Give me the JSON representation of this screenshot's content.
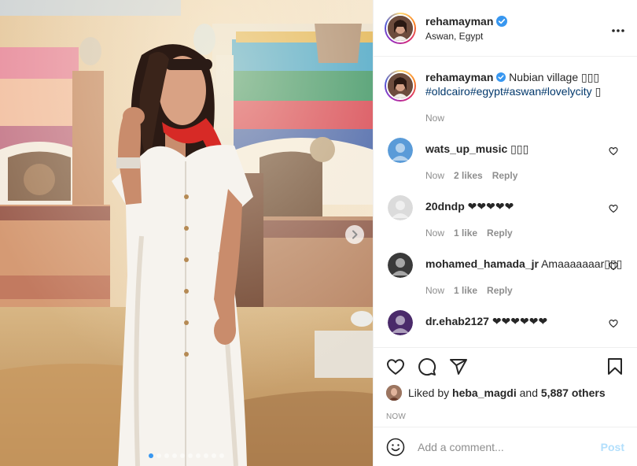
{
  "post": {
    "username": "rehamayman",
    "location": "Aswan, Egypt",
    "more_icon": "more-horizontal-icon"
  },
  "caption": {
    "username": "rehamayman",
    "text": "Nubian village ▯▯▯",
    "hashtags": "#oldcairo#egypt#aswan#lovelycity",
    "trailing": "▯",
    "time": "Now"
  },
  "comments": [
    {
      "username": "wats_up_music",
      "text": "▯▯▯",
      "time": "Now",
      "likes": "2 likes",
      "reply": "Reply",
      "avatar_color": "#5a9bd8"
    },
    {
      "username": "20dndp",
      "text": "❤❤❤❤❤",
      "time": "Now",
      "likes": "1 like",
      "reply": "Reply",
      "avatar_color": "#dbdbdb"
    },
    {
      "username": "mohamed_hamada_jr",
      "text": "Amaaaaaaar▯▯▯",
      "time": "Now",
      "likes": "1 like",
      "reply": "Reply",
      "avatar_color": "#3a3a3a"
    },
    {
      "username": "dr.ehab2127",
      "text": "❤❤❤❤❤❤",
      "time": "",
      "likes": "",
      "reply": "",
      "avatar_color": "#4a2a6a"
    }
  ],
  "likes": {
    "prefix": "Liked by",
    "user": "heba_magdi",
    "and": "and",
    "others": "5,887 others"
  },
  "timestamp": "NOW",
  "add_comment": {
    "placeholder": "Add a comment...",
    "post_label": "Post"
  },
  "carousel": {
    "total": 10,
    "active": 1
  },
  "colors": {
    "verified": "#3897f0",
    "link": "#00376b",
    "muted": "#8e8e8e",
    "post_disabled": "#b2dffc"
  }
}
